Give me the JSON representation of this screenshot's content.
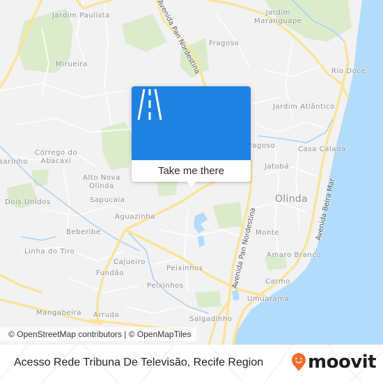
{
  "map": {
    "colors": {
      "land": "#f2f2f3",
      "water": "#b3dcfa",
      "park": "#d8ebc8",
      "major_road": "#fbe39a",
      "minor_road": "#ffffff",
      "river": "#a9d3f5"
    },
    "place_labels": [
      {
        "name": "Jardim Paulista"
      },
      {
        "name": "Mirueira"
      },
      {
        "name": "Jardim\nMaranguape"
      },
      {
        "name": "Fragoso"
      },
      {
        "name": "Rio Doce"
      },
      {
        "name": "Jardim Atlântico"
      },
      {
        "name": "Fragoso"
      },
      {
        "name": "Casa Calada"
      },
      {
        "name": "Jatobá"
      },
      {
        "name": "Olinda"
      },
      {
        "name": "Córrego do\nAbacaxi"
      },
      {
        "name": "Passarinho"
      },
      {
        "name": "Alto Nova\nOlinda"
      },
      {
        "name": "Dois Unidos"
      },
      {
        "name": "Sapucaia"
      },
      {
        "name": "Aguazinha"
      },
      {
        "name": "Beberibe"
      },
      {
        "name": "Linha do Tiro"
      },
      {
        "name": "Cajueiro"
      },
      {
        "name": "Fundão"
      },
      {
        "name": "Peixinhos"
      },
      {
        "name": "Peixinhos"
      },
      {
        "name": "Monte"
      },
      {
        "name": "Amaro Branco"
      },
      {
        "name": "Carmo"
      },
      {
        "name": "Umuarama"
      },
      {
        "name": "Mangabeira"
      },
      {
        "name": "Arruda"
      },
      {
        "name": "Salgadinho"
      }
    ],
    "road_labels": [
      {
        "name": "Avenida Pan Nordestina"
      },
      {
        "name": "Avenida Pan Nordestina"
      },
      {
        "name": "Avenida Beira Mar"
      }
    ],
    "attribution": "© OpenStreetMap contributors | © OpenMapTiles"
  },
  "popup": {
    "icon": "road-icon",
    "button_label": "Take me there",
    "header_color": "#1f82e1"
  },
  "footer": {
    "title": "Acesso Rede Tribuna De Televisão, Recife Region",
    "logo_text": "moovit",
    "logo_icon": "moovit-pin-icon",
    "logo_color": "#f26a2e"
  }
}
